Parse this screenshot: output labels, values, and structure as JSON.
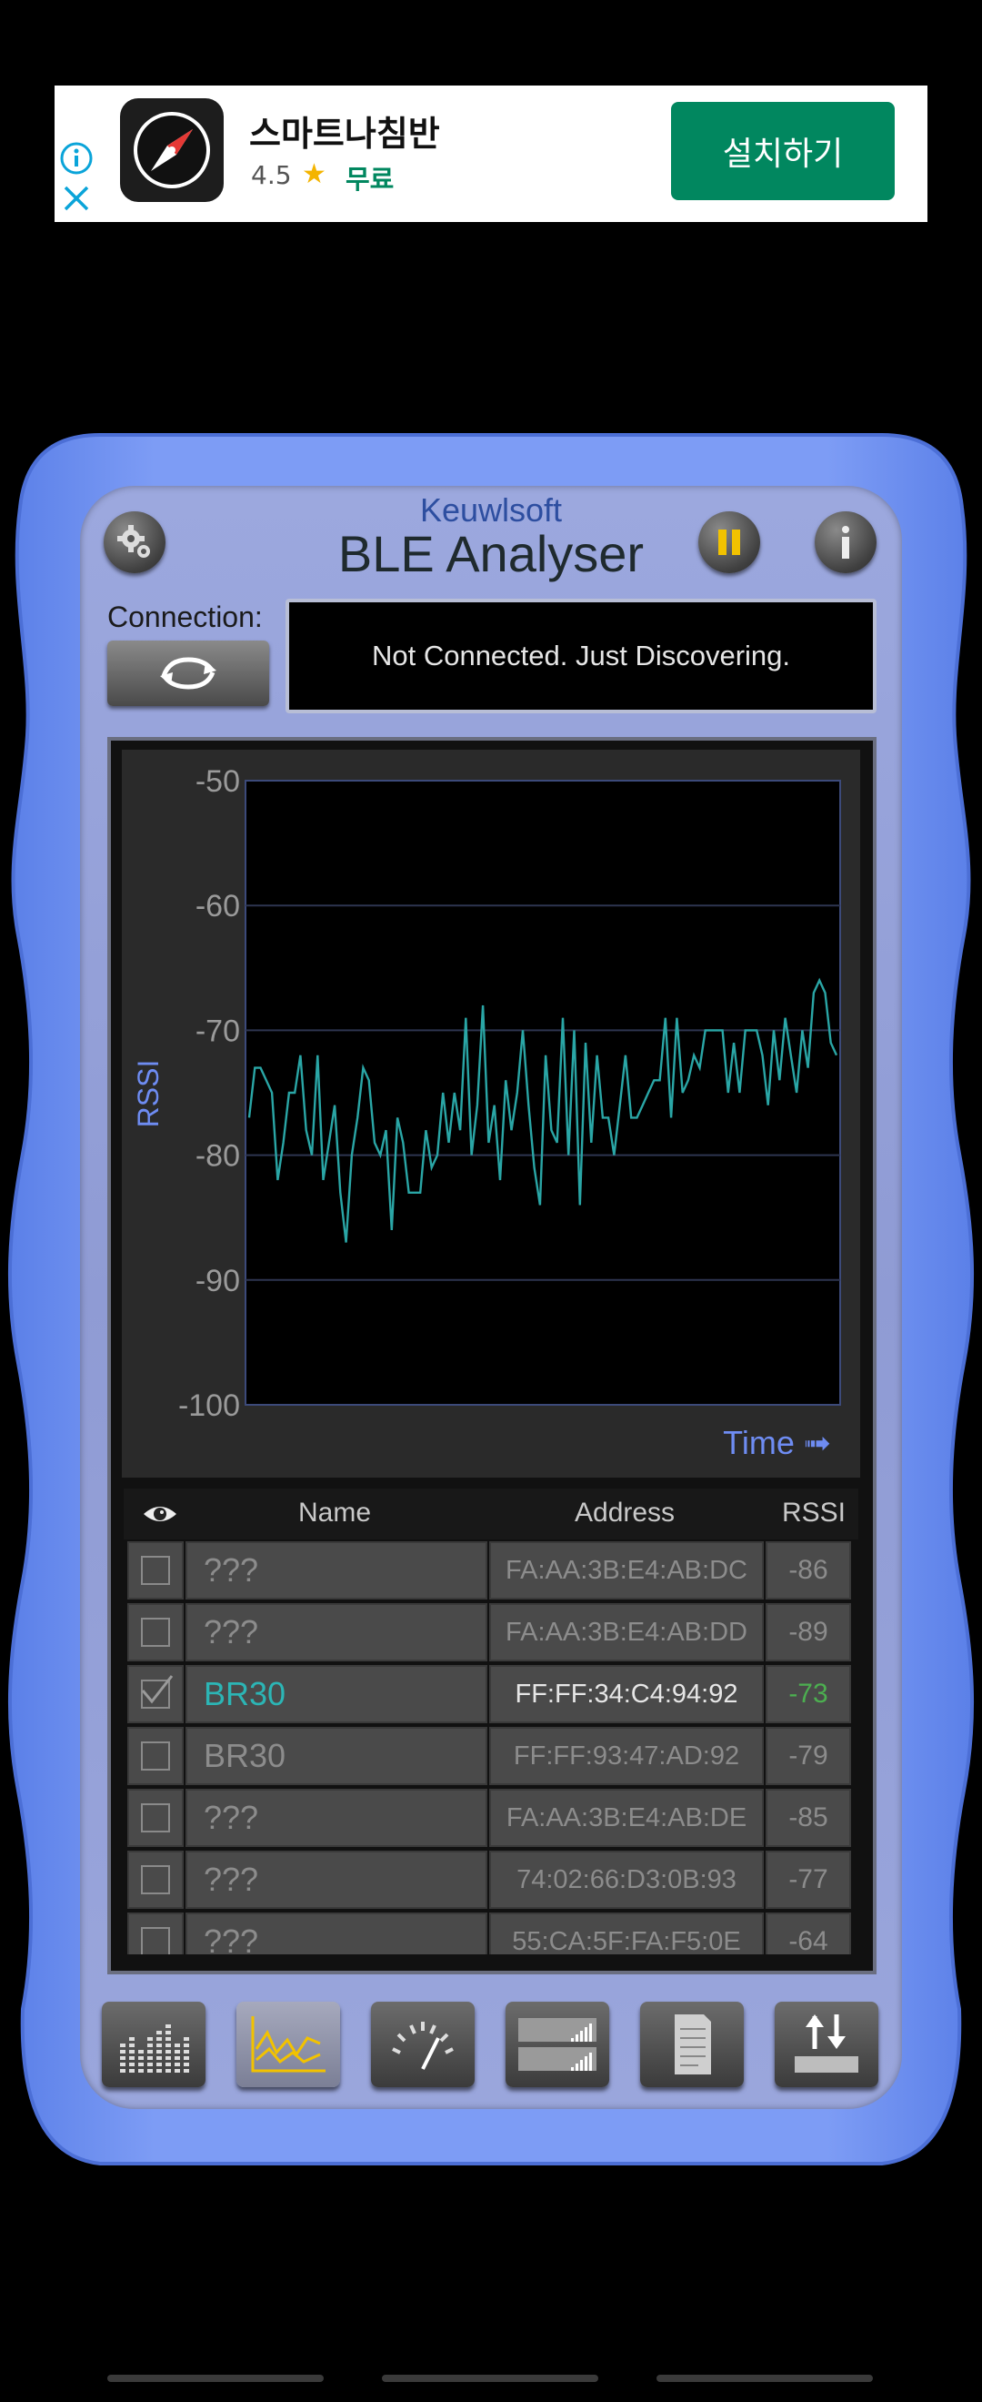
{
  "ad": {
    "title": "스마트나침반",
    "rating": "4.5",
    "price": "무료",
    "install_label": "설치하기",
    "colors": {
      "install_bg": "#01875f",
      "star": "#f4b400"
    }
  },
  "app": {
    "brand": "Keuwlsoft",
    "title": "BLE Analyser",
    "connection_label": "Connection:",
    "status_text": "Not Connected.  Just Discovering."
  },
  "chart_data": {
    "type": "line",
    "ylabel": "RSSI",
    "xlabel": "Time ➟",
    "ylim": [
      -100,
      -50
    ],
    "yticks": [
      "-50",
      "-60",
      "-70",
      "-80",
      "-90",
      "-100"
    ],
    "grid": true,
    "series": [
      {
        "color": "#2aa6a6",
        "values": [
          -77,
          -73,
          -73,
          -74,
          -75,
          -82,
          -79,
          -75,
          -75,
          -72,
          -78,
          -80,
          -72,
          -82,
          -79,
          -76,
          -83,
          -87,
          -80,
          -77,
          -73,
          -74,
          -79,
          -80,
          -78,
          -86,
          -77,
          -79,
          -83,
          -83,
          -83,
          -78,
          -81,
          -80,
          -75,
          -79,
          -75,
          -78,
          -69,
          -80,
          -76,
          -68,
          -79,
          -76,
          -82,
          -74,
          -78,
          -75,
          -70,
          -76,
          -81,
          -84,
          -72,
          -78,
          -79,
          -69,
          -80,
          -70,
          -84,
          -71,
          -79,
          -72,
          -77,
          -77,
          -80,
          -76,
          -72,
          -77,
          -77,
          -76,
          -75,
          -74,
          -74,
          -69,
          -77,
          -69,
          -75,
          -74,
          -72,
          -73,
          -70,
          -70,
          -70,
          -70,
          -75,
          -71,
          -75,
          -70,
          -70,
          -70,
          -72,
          -76,
          -70,
          -74,
          -69,
          -72,
          -75,
          -70,
          -73,
          -67,
          -66,
          -67,
          -71,
          -72
        ]
      }
    ]
  },
  "table": {
    "header": {
      "name": "Name",
      "address": "Address",
      "rssi": "RSSI"
    },
    "rows": [
      {
        "name": "???",
        "address": "FA:AA:3B:E4:AB:DC",
        "rssi": "-86",
        "checked": false
      },
      {
        "name": "???",
        "address": "FA:AA:3B:E4:AB:DD",
        "rssi": "-89",
        "checked": false
      },
      {
        "name": "BR30",
        "address": "FF:FF:34:C4:94:92",
        "rssi": "-73",
        "checked": true
      },
      {
        "name": "BR30",
        "address": "FF:FF:93:47:AD:92",
        "rssi": "-79",
        "checked": false
      },
      {
        "name": "???",
        "address": "FA:AA:3B:E4:AB:DE",
        "rssi": "-85",
        "checked": false
      },
      {
        "name": "???",
        "address": "74:02:66:D3:0B:93",
        "rssi": "-77",
        "checked": false
      },
      {
        "name": "???",
        "address": "55:CA:5F:FA:F5:0E",
        "rssi": "-64",
        "checked": false
      }
    ]
  },
  "toolbar": {
    "items": [
      {
        "icon": "bar-chart-icon",
        "active": false
      },
      {
        "icon": "line-chart-icon",
        "active": true
      },
      {
        "icon": "gauge-icon",
        "active": false
      },
      {
        "icon": "signal-bars-icon",
        "active": false
      },
      {
        "icon": "document-icon",
        "active": false
      },
      {
        "icon": "upload-download-icon",
        "active": false
      }
    ]
  }
}
